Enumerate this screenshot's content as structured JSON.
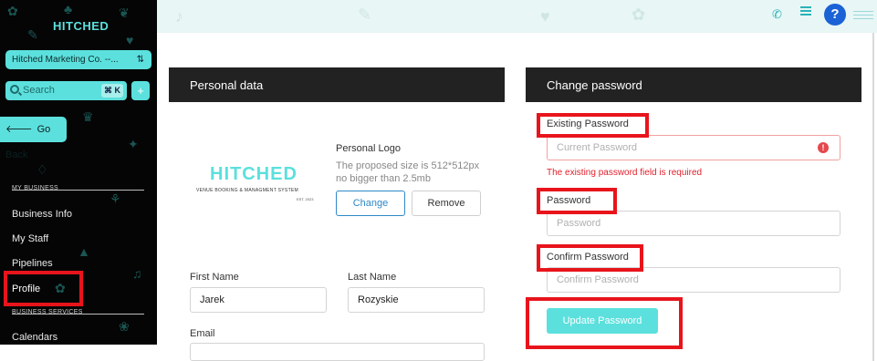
{
  "sidebar": {
    "brand": "HITCHED",
    "org_select": "Hitched Marketing Co. --...",
    "search_placeholder": "Search",
    "search_shortcut": "⌘ K",
    "add_label": "+",
    "go_back": "Go Back",
    "sections": [
      {
        "title": "MY BUSINESS",
        "items": [
          "Business Info",
          "My Staff",
          "Pipelines",
          "Profile"
        ]
      },
      {
        "title": "BUSINESS SERVICES",
        "items": [
          "Calendars"
        ]
      }
    ]
  },
  "header": {
    "icons": [
      "phone-icon",
      "list-icon",
      "help-icon",
      "menu-icon"
    ],
    "help_label": "?"
  },
  "personal": {
    "title": "Personal data",
    "logo_text": "HITCHED",
    "logo_subtitle": "VENUE BOOKING & MANAGMENT SYSTEM",
    "logo_tag": "EST. 2023",
    "logo_label": "Personal Logo",
    "logo_hint_1": "The proposed size is 512*512px",
    "logo_hint_2": "no bigger than 2.5mb",
    "change_label": "Change",
    "remove_label": "Remove",
    "first_name_label": "First Name",
    "first_name_value": "Jarek",
    "last_name_label": "Last Name",
    "last_name_value": "Rozyskie",
    "email_label": "Email"
  },
  "password": {
    "title": "Change password",
    "existing_label": "Existing Password",
    "existing_placeholder": "Current Password",
    "existing_error": "The existing password field is required",
    "password_label": "Password",
    "password_placeholder": "Password",
    "confirm_label": "Confirm Password",
    "confirm_placeholder": "Confirm Password",
    "update_label": "Update Password"
  },
  "colors": {
    "accent": "#5ce0dd",
    "highlight": "#e8141c",
    "error": "#e0202c",
    "sidebar_bg": "#050505",
    "card_header": "#222222"
  }
}
